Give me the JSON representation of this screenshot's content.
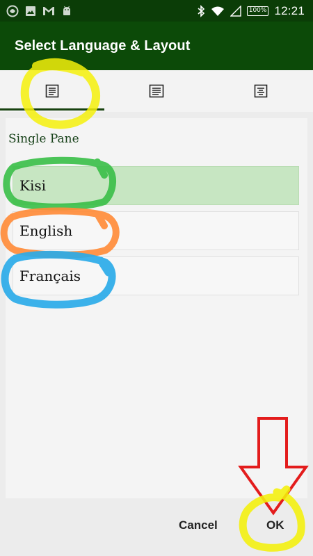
{
  "status_bar": {
    "battery": "100%",
    "time": "12:21",
    "icons": [
      "app-icon",
      "image-icon",
      "gmail-icon",
      "android-icon",
      "bluetooth-icon",
      "wifi-icon",
      "signal-icon",
      "battery-icon"
    ]
  },
  "app_bar": {
    "title": "Select Language & Layout",
    "background": "#0c4a08"
  },
  "tabs": [
    {
      "icon": "single-pane-layout-icon",
      "selected": true
    },
    {
      "icon": "two-pane-layout-icon",
      "selected": false
    },
    {
      "icon": "three-pane-layout-icon",
      "selected": false
    }
  ],
  "main": {
    "pane_label": "Single Pane",
    "languages": [
      {
        "label": "Kisi",
        "selected": true
      },
      {
        "label": "English",
        "selected": false
      },
      {
        "label": "Français",
        "selected": false
      }
    ]
  },
  "actions": {
    "cancel_label": "Cancel",
    "ok_label": "OK"
  },
  "colors": {
    "selected_row": "#c7e6c2",
    "annotation_yellow": "#f4f00a",
    "annotation_green": "#3cbf4a",
    "annotation_orange": "#ff8c3a",
    "annotation_blue": "#2aaae8",
    "annotation_red": "#e31c1c"
  }
}
